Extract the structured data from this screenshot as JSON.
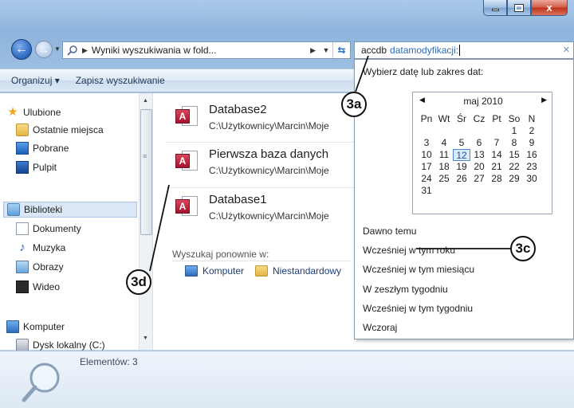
{
  "window": {
    "controls": {
      "minimize": "minimize-icon",
      "maximize": "maximize-icon",
      "close": "x"
    }
  },
  "nav": {
    "back": "back-arrow-icon",
    "forward": "forward-arrow-icon",
    "address": "Wyniki wyszukiwania w fold...",
    "search": {
      "query": "accdb",
      "filter": "datamodyfikacji:"
    }
  },
  "toolbar": {
    "organize": "Organizuj",
    "save_search": "Zapisz wyszukiwanie"
  },
  "sidebar": {
    "favorites": "Ulubione",
    "recent": "Ostatnie miejsca",
    "downloads": "Pobrane",
    "desktop": "Pulpit",
    "libraries": "Biblioteki",
    "documents": "Dokumenty",
    "music": "Muzyka",
    "pictures": "Obrazy",
    "videos": "Wideo",
    "computer": "Komputer",
    "local_disk": "Dysk lokalny (C:)"
  },
  "files": [
    {
      "name": "Database2",
      "path": "C:\\Użytkownicy\\Marcin\\Moje"
    },
    {
      "name": "Pierwsza baza danych",
      "path": "C:\\Użytkownicy\\Marcin\\Moje"
    },
    {
      "name": "Database1",
      "path": "C:\\Użytkownicy\\Marcin\\Moje"
    }
  ],
  "search_again": {
    "label": "Wyszukaj ponownie w:",
    "computer": "Komputer",
    "custom": "Niestandardowy"
  },
  "date_filter": {
    "heading": "Wybierz datę lub zakres dat:",
    "calendar": {
      "month": "maj 2010",
      "weekdays": [
        "Pn",
        "Wt",
        "Śr",
        "Cz",
        "Pt",
        "So",
        "N"
      ],
      "weeks": [
        [
          "",
          "",
          "",
          "",
          "",
          "1",
          "2"
        ],
        [
          "3",
          "4",
          "5",
          "6",
          "7",
          "8",
          "9"
        ],
        [
          "10",
          "11",
          "12",
          "13",
          "14",
          "15",
          "16"
        ],
        [
          "17",
          "18",
          "19",
          "20",
          "21",
          "22",
          "23"
        ],
        [
          "24",
          "25",
          "26",
          "27",
          "28",
          "29",
          "30"
        ],
        [
          "31",
          "",
          "",
          "",
          "",
          "",
          ""
        ]
      ],
      "today": "12"
    },
    "options": [
      "Dawno temu",
      "Wcześniej w tym roku",
      "Wcześniej w tym miesiącu",
      "W zeszłym tygodniu",
      "Wcześniej w tym tygodniu",
      "Wczoraj"
    ]
  },
  "details": {
    "count": "Elementów: 3"
  },
  "callouts": {
    "a": "3a",
    "c": "3c",
    "d": "3d"
  }
}
